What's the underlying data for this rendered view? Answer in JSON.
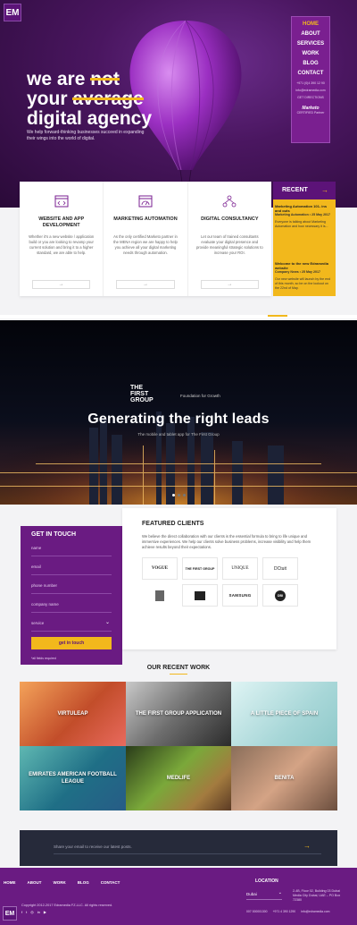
{
  "brand": {
    "logo": "EM"
  },
  "hero": {
    "line1a": "we are ",
    "line1b": "not",
    "line2a": "your ",
    "line2b": "average",
    "line3": "digital agency",
    "subtitle": "We help forward-thinking businesses succeed in expanding their wings into the world of digital."
  },
  "nav": {
    "items": [
      "HOME",
      "ABOUT",
      "SERVICES",
      "WORK",
      "BLOG",
      "CONTACT"
    ],
    "phone": "+971 (0)4 390 12 90",
    "email": "info@edramedia.com",
    "extra": "GET DIRECTIONS",
    "partner_title": "Marketo",
    "partner_sub": "CERTIFIED Partner"
  },
  "services": [
    {
      "title": "Website and App Development",
      "desc": "Whether it's a new website / application build or you are looking to revamp your current solution and bring it to a higher standard, we are able to help.",
      "icon": "code-window-icon"
    },
    {
      "title": "Marketing Automation",
      "desc": "As the only certified Marketo partner in the MENA region we are happy to help you achieve all your digital marketing needs through automation.",
      "icon": "gauge-window-icon"
    },
    {
      "title": "Digital Consultancy",
      "desc": "Let our team of trained consultants evaluate your digital presence and provide meaningful strategic solutions to increase your ROI.",
      "icon": "network-icon"
    }
  ],
  "recent": {
    "title": "RECENT",
    "posts": [
      {
        "title": "Marketing Automation 101- ins and outs",
        "category": "Marketing Automation",
        "date": "25 May 2017",
        "excerpt": "Everyone is talking about Marketing Automation and how necessary it is..."
      },
      {
        "title": "Welcome to the new Edramedia website",
        "category": "Company News",
        "date": "25 May 2017",
        "excerpt": "Our new website will launch by the end of this month, so be on the lookout on the 22nd of May."
      }
    ]
  },
  "banner": {
    "brand_line1": "THE",
    "brand_line2": "FIRST",
    "brand_line3": "GROUP",
    "tagline": "Foundation for Growth",
    "title": "Generating the right leads",
    "subtitle": "The mobile and tablet app for The First Group"
  },
  "touch": {
    "title": "GET IN TOUCH",
    "fields": [
      "name",
      "email",
      "phone number",
      "company name",
      "service"
    ],
    "button": "get in touch",
    "required": "*all fields required"
  },
  "clients": {
    "title": "FEATURED CLIENTS",
    "desc": "We believe the direct collaboration with our clients is the essential formula to bring to life unique and immersive experiences. We help our clients solve business problems, increase visibility and help them achieve results beyond their expectations.",
    "row1": [
      "VOGUE",
      "THE FIRST GROUP",
      "UNIQUE",
      "DCtuit"
    ],
    "row2": [
      "",
      "",
      "SAMSUNG",
      "DBI"
    ]
  },
  "recent_work": {
    "title": "OUR RECENT WORK",
    "items": [
      "VIRTULEAP",
      "THE FIRST GROUP APPLICATION",
      "A LITTLE PIECE OF SPAIN",
      "EMIRATES AMERICAN FOOTBALL LEAGUE",
      "MEDLIFE",
      "BENITA"
    ]
  },
  "newsletter": {
    "placeholder": "Share your email to receive our latest posts."
  },
  "footer": {
    "nav": [
      "HOME",
      "ABOUT",
      "WORK",
      "BLOG",
      "CONTACT"
    ],
    "copyright": "Copyright 2012-2017 Edramedia FZ-LLC. All rights reserved.",
    "location_label": "LOCATION",
    "city": "Dubai",
    "address": "2-4B, Floor 02, Building 03 Dubai Media City Dubai, UAE – PO Box 72380",
    "contacts": [
      "007 000001300",
      "+971 4 390 1290",
      "info@edramedia.com"
    ]
  },
  "colors": {
    "purple": "#6a1b82",
    "dark_purple": "#5c1378",
    "accent": "#f2b81c",
    "navy": "#262a3a"
  }
}
